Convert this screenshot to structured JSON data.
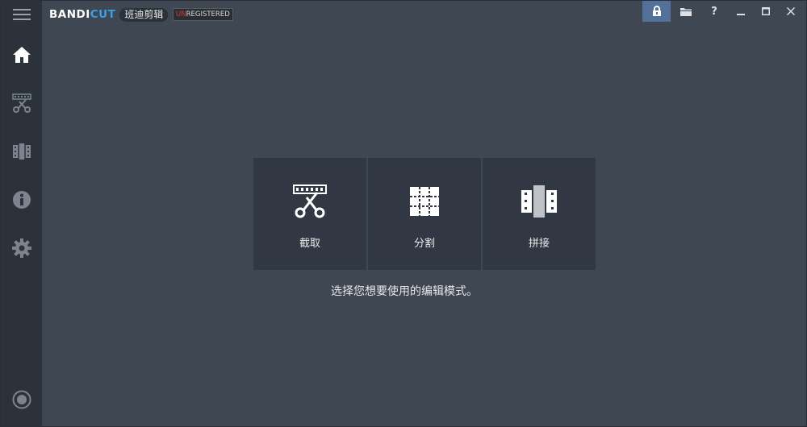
{
  "app": {
    "brand_part1": "BANDI",
    "brand_part2": "CUT",
    "brand_cn": "班迪剪辑",
    "registration_red": "UN",
    "registration_rest": "REGISTERED"
  },
  "titlebar_buttons": [
    "lock-icon",
    "folder-icon",
    "help-icon",
    "minimize-icon",
    "maximize-icon",
    "close-icon"
  ],
  "help_label": "?",
  "sidebar": [
    "menu-icon",
    "home-icon",
    "trim-icon",
    "join-icon",
    "info-icon",
    "settings-icon",
    "record-icon"
  ],
  "main": {
    "cards": [
      {
        "label": "截取",
        "icon": "trim-icon"
      },
      {
        "label": "分割",
        "icon": "split-icon"
      },
      {
        "label": "拼接",
        "icon": "join-icon"
      }
    ],
    "prompt": "选择您想要使用的编辑模式。"
  },
  "colors": {
    "background": "#3f4753",
    "sidebar": "#2c323a",
    "card": "#313843",
    "accent": "#3aa0e4",
    "lock_active": "#52709a",
    "unregistered_red": "#e0322f"
  }
}
